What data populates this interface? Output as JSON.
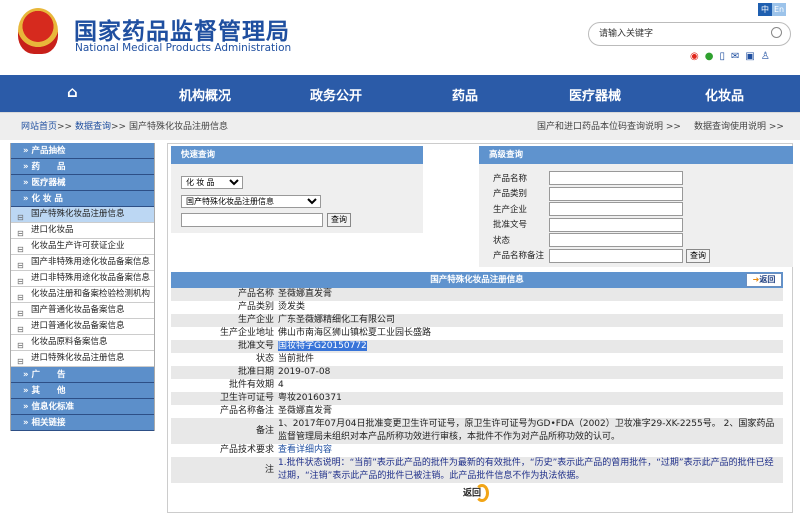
{
  "header": {
    "title": "国家药品监督管理局",
    "subtitle": "National Medical Products Administration",
    "lang_zh": "中",
    "lang_en": "En",
    "search_placeholder": "请输入关键字"
  },
  "nav": [
    "机构概况",
    "政务公开",
    "药品",
    "医疗器械",
    "化妆品"
  ],
  "breadcrumb": {
    "home": "网站首页",
    "sep": ">>",
    "data": "数据查询",
    "current": "国产特殊化妆品注册信息",
    "link1": "国产和进口药品本位码查询说明 >>",
    "link2": "数据查询使用说明 >>"
  },
  "sidebar": {
    "heads_top": [
      "» 产品抽检",
      "» 药　　品",
      "» 医疗器械",
      "» 化 妆 品"
    ],
    "items": [
      "国产特殊化妆品注册信息",
      "进口化妆品",
      "化妆品生产许可获证企业",
      "国产非特殊用途化妆品备案信息",
      "进口非特殊用途化妆品备案信息",
      "化妆品注册和备案检验检测机构",
      "国产普通化妆品备案信息",
      "进口普通化妆品备案信息",
      "化妆品原料备案信息",
      "进口特殊化妆品注册信息"
    ],
    "heads_bottom": [
      "» 广　　告",
      "» 其　　他",
      "» 信息化标准",
      "» 相关链接"
    ]
  },
  "quick": {
    "title": "快速查询",
    "select1": "化 妆 品",
    "select2": "国产特殊化妆品注册信息",
    "query": "查询"
  },
  "advanced": {
    "title": "高级查询",
    "fields": [
      "产品名称",
      "产品类别",
      "生产企业",
      "批准文号",
      "状态",
      "产品名称备注"
    ],
    "query": "查询"
  },
  "detail": {
    "title": "国产特殊化妆品注册信息",
    "back": "返回",
    "rows": [
      {
        "label": "产品名称",
        "value": "圣薇娜直发膏"
      },
      {
        "label": "产品类别",
        "value": "烫发类"
      },
      {
        "label": "生产企业",
        "value": "广东圣薇娜精细化工有限公司"
      },
      {
        "label": "生产企业地址",
        "value": "佛山市南海区狮山镇松夏工业园长盛路"
      },
      {
        "label": "批准文号",
        "value": "国妆特字G20150772"
      },
      {
        "label": "状态",
        "value": "当前批件"
      },
      {
        "label": "批准日期",
        "value": "2019-07-08"
      },
      {
        "label": "批件有效期",
        "value": "4"
      },
      {
        "label": "卫生许可证号",
        "value": "粤妆20160371"
      },
      {
        "label": "产品名称备注",
        "value": "圣薇娜直发膏"
      },
      {
        "label": "备注",
        "value": "1、2017年07月04日批准变更卫生许可证号，原卫生许可证号为GD•FDA（2002）卫妆准字29-XK-2255号。 2、国家药品监督管理局未组织对本产品所称功效进行审核，本批件不作为对产品所称功效的认可。"
      },
      {
        "label": "产品技术要求",
        "value": "查看详细内容"
      },
      {
        "label": "注",
        "value": "1.批件状态说明：“当前”表示此产品的批件为最新的有效批件，“历史”表示此产品的曾用批件，“过期”表示此产品的批件已经过期，“注销”表示此产品的批件已被注销。此产品批件信息不作为执法依据。"
      }
    ],
    "back_bottom": "返回"
  }
}
